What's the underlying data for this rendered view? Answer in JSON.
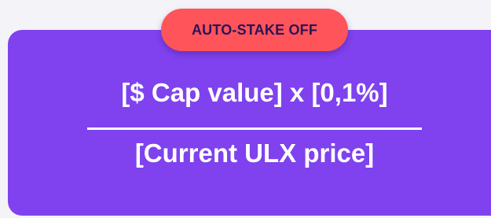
{
  "badge": {
    "label": "AUTO-STAKE OFF"
  },
  "formula": {
    "numerator": "[$ Cap value] x [0,1%]",
    "denominator": "[Current ULX price]"
  },
  "colors": {
    "card_background": "#7f42ee",
    "badge_background": "#ff545a",
    "badge_text": "#2a1458",
    "formula_text": "#ffffff"
  }
}
